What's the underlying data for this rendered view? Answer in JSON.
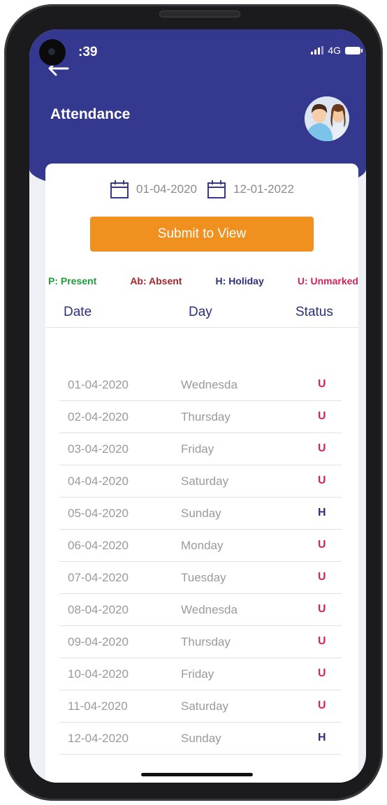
{
  "status_bar": {
    "time": ":39",
    "network": "4G"
  },
  "header": {
    "title": "Attendance"
  },
  "filter": {
    "from_date": "01-04-2020",
    "to_date": "12-01-2022",
    "submit_label": "Submit to View"
  },
  "legend": {
    "present": "P: Present",
    "absent": "Ab: Absent",
    "holiday": "H: Holiday",
    "unmarked": "U: Unmarked"
  },
  "table": {
    "headers": {
      "date": "Date",
      "day": "Day",
      "status": "Status"
    },
    "rows": [
      {
        "date": "01-04-2020",
        "day": "Wednesda",
        "status": "U"
      },
      {
        "date": "02-04-2020",
        "day": "Thursday",
        "status": "U"
      },
      {
        "date": "03-04-2020",
        "day": "Friday",
        "status": "U"
      },
      {
        "date": "04-04-2020",
        "day": "Saturday",
        "status": "U"
      },
      {
        "date": "05-04-2020",
        "day": "Sunday",
        "status": "H"
      },
      {
        "date": "06-04-2020",
        "day": "Monday",
        "status": "U"
      },
      {
        "date": "07-04-2020",
        "day": "Tuesday",
        "status": "U"
      },
      {
        "date": "08-04-2020",
        "day": "Wednesda",
        "status": "U"
      },
      {
        "date": "09-04-2020",
        "day": "Thursday",
        "status": "U"
      },
      {
        "date": "10-04-2020",
        "day": "Friday",
        "status": "U"
      },
      {
        "date": "11-04-2020",
        "day": "Saturday",
        "status": "U"
      },
      {
        "date": "12-04-2020",
        "day": "Sunday",
        "status": "H"
      }
    ]
  },
  "colors": {
    "header_bg": "#34388f",
    "accent_button": "#f0901f",
    "present": "#1f9a3a",
    "absent": "#a3252c",
    "holiday": "#2c2f7c",
    "unmarked": "#d0245a",
    "heading_text": "#2c2f7c"
  },
  "icons": {
    "back": "arrow-left-icon",
    "calendar": "calendar-icon",
    "avatar": "users-avatar-icon"
  }
}
